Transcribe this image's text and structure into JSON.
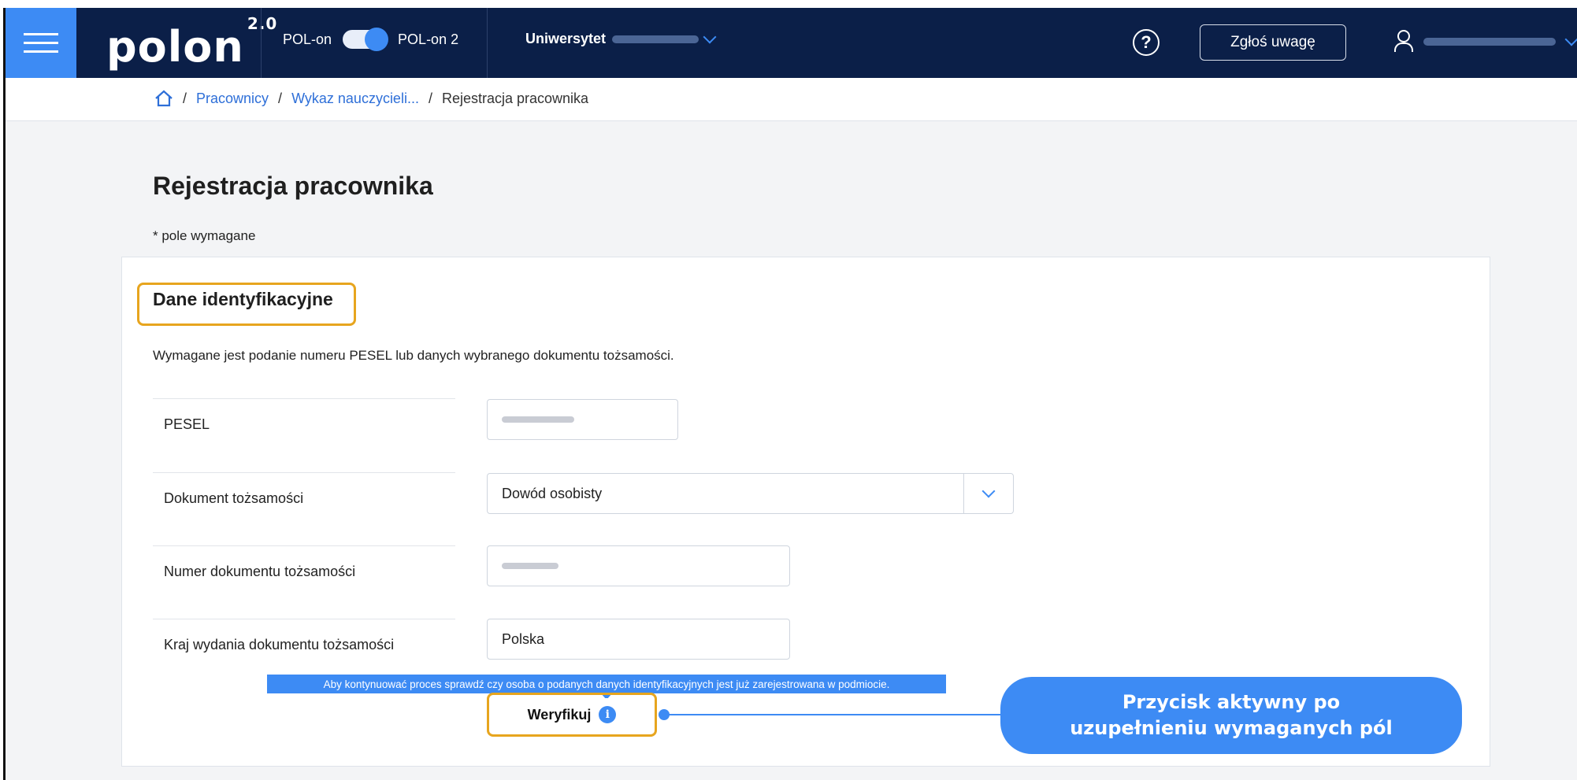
{
  "header": {
    "logo": "polon",
    "logo_version": "2.0",
    "toggle_left_label": "POL-on",
    "toggle_right_label": "POL-on 2",
    "university_label": "Uniwersytet",
    "help_symbol": "?",
    "report_button": "Zgłoś uwagę"
  },
  "breadcrumb": {
    "items": [
      "Pracownicy",
      "Wykaz nauczycieli...",
      "Rejestracja pracownika"
    ],
    "separator": "/"
  },
  "page": {
    "title": "Rejestracja pracownika",
    "required_note": "* pole wymagane"
  },
  "section": {
    "title": "Dane identyfikacyjne",
    "instruction": "Wymagane jest podanie numeru PESEL lub danych wybranego dokumentu tożsamości."
  },
  "fields": {
    "pesel_label": "PESEL",
    "document_label": "Dokument tożsamości",
    "document_value": "Dowód osobisty",
    "document_number_label": "Numer dokumentu tożsamości",
    "issuing_country_label": "Kraj wydania dokumentu tożsamości",
    "issuing_country_value": "Polska"
  },
  "verify": {
    "tooltip": "Aby kontynuować proces sprawdź czy osoba o podanych danych identyfikacyjnych jest już zarejestrowana w podmiocie.",
    "button_label": "Weryfikuj",
    "info_symbol": "i"
  },
  "callout": {
    "text": "Przycisk aktywny po uzupełnieniu wymaganych pól"
  },
  "colors": {
    "header_bg": "#0b1f48",
    "accent": "#3d8bf4",
    "highlight": "#e7a51e"
  }
}
